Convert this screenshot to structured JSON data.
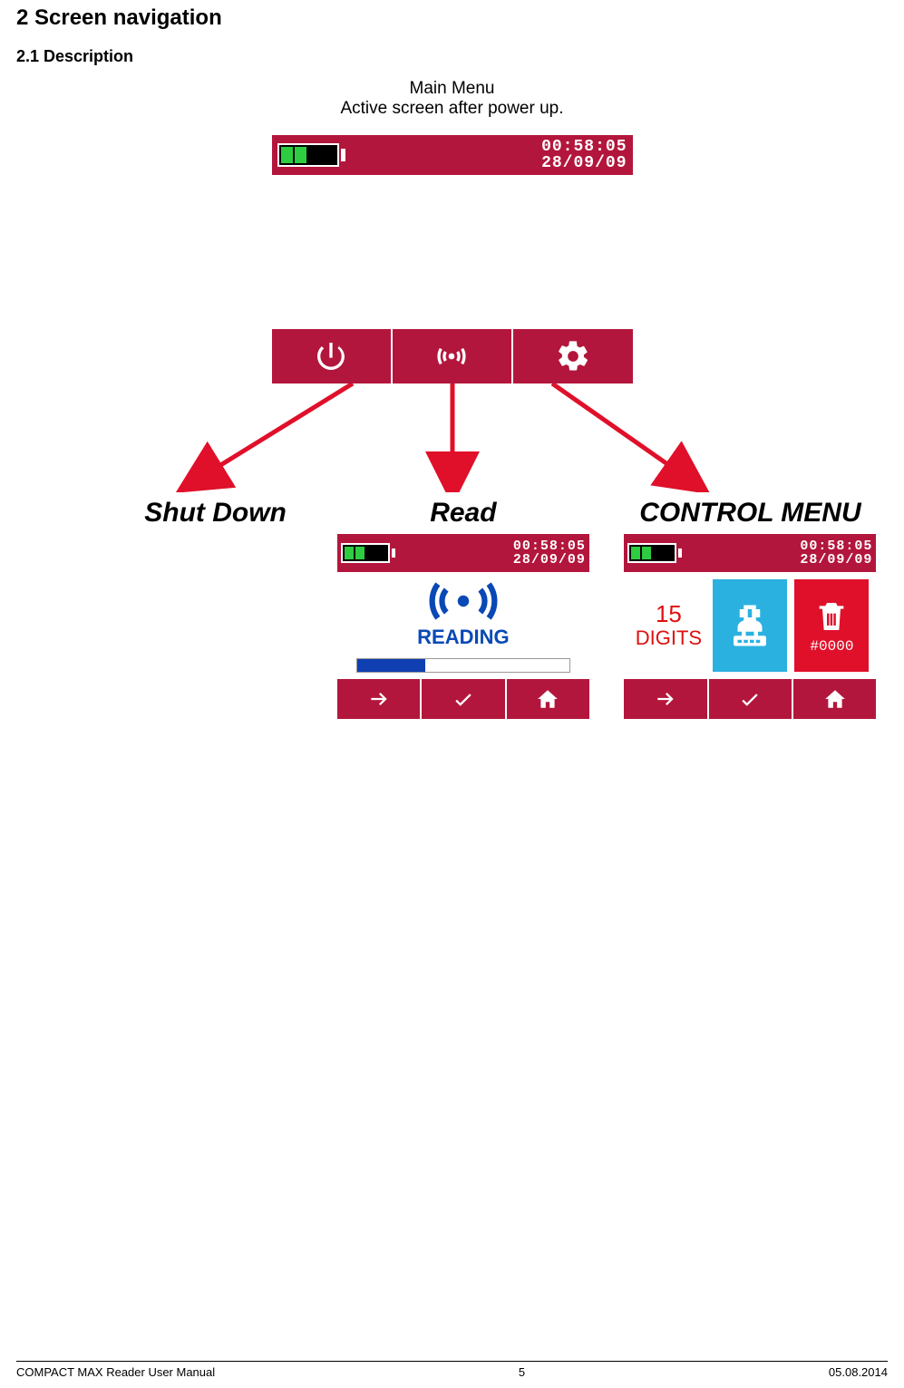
{
  "headings": {
    "section": "2    Screen navigation",
    "subsection": "2.1      Description"
  },
  "main_menu": {
    "title": "Main Menu",
    "subtitle": "Active screen after power up.",
    "time": "00:58:05",
    "date": "28/09/09"
  },
  "menu_buttons": {
    "shutdown_label": "Shut Down",
    "read_label": "Read",
    "control_label": "CONTROL MENU"
  },
  "read_screen": {
    "time": "00:58:05",
    "date": "28/09/09",
    "status": "READING"
  },
  "control_screen": {
    "time": "00:58:05",
    "date": "28/09/09",
    "digits_num": "15",
    "digits_label": "DIGITS",
    "trash_count": "#0000"
  },
  "footer": {
    "left": "COMPACT MAX Reader User Manual",
    "center": "5",
    "right": "05.08.2014"
  }
}
